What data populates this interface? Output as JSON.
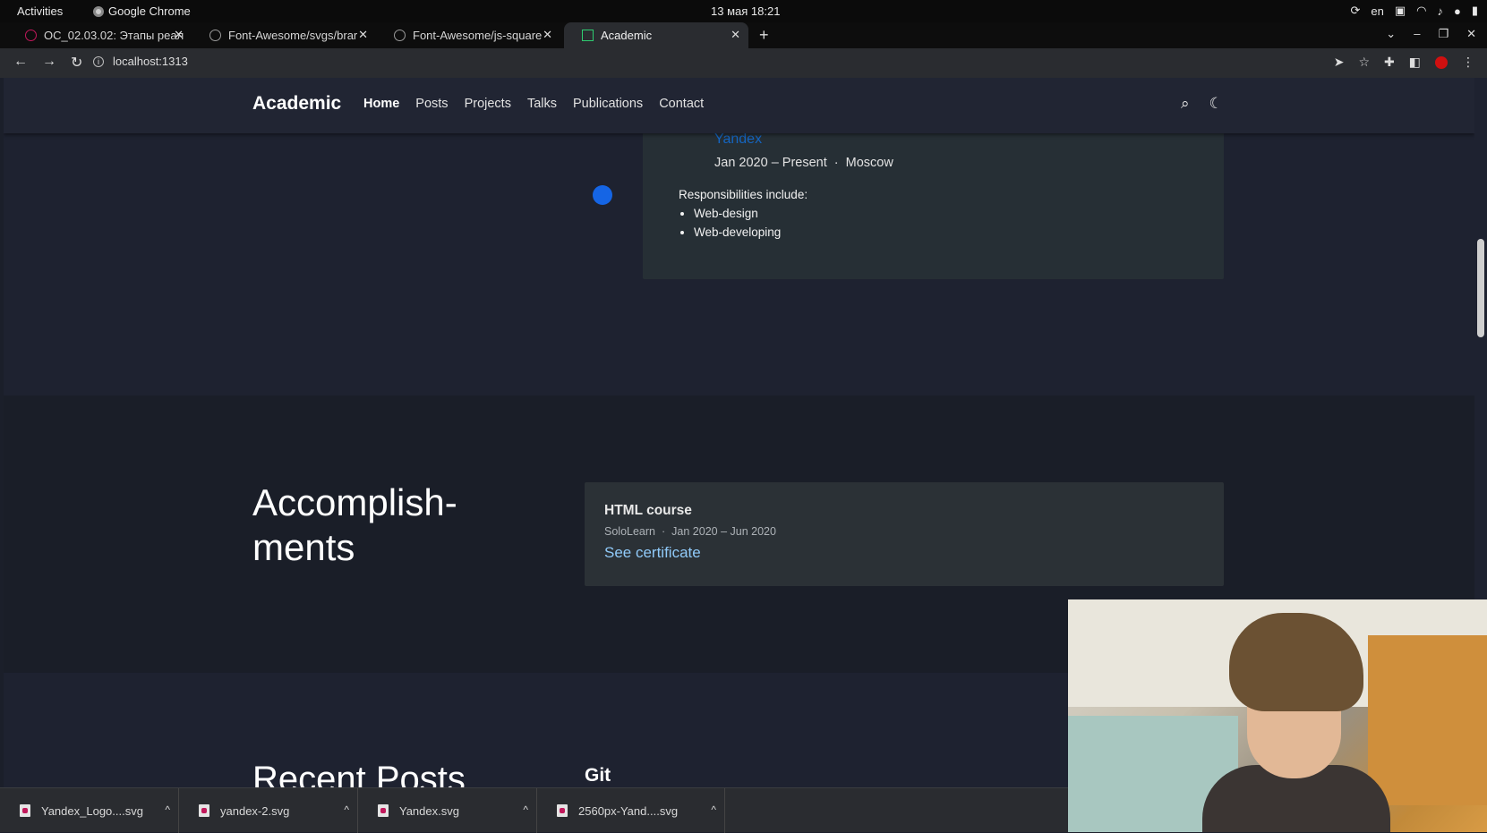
{
  "system_bar": {
    "activities": "Activities",
    "app_name": "Google Chrome",
    "clock": "13 мая  18:21",
    "lang": "en"
  },
  "tabs": [
    {
      "title": "ОС_02.03.02: Этапы реал"
    },
    {
      "title": "Font-Awesome/svgs/brar"
    },
    {
      "title": "Font-Awesome/js-square"
    },
    {
      "title": "Academic"
    }
  ],
  "address_bar": {
    "url": "localhost:1313"
  },
  "site": {
    "brand": "Academic",
    "menu": [
      "Home",
      "Posts",
      "Projects",
      "Talks",
      "Publications",
      "Contact"
    ]
  },
  "experience": {
    "company": "Yandex",
    "dates": "Jan 2020 – Present",
    "separator": "·",
    "location": "Moscow",
    "responsibilities_label": "Responsibilities include:",
    "items": [
      "Web-design",
      "Web-developing"
    ]
  },
  "accomplishments": {
    "section_title_line1": "Accomplish-",
    "section_title_line2": "ments",
    "card": {
      "name": "HTML course",
      "organization": "SoloLearn",
      "separator": "·",
      "dates": "Jan 2020 – Jun 2020",
      "link": "See certificate"
    }
  },
  "recent_posts": {
    "section_title": "Recent Posts",
    "first_post": "Git"
  },
  "downloads": [
    {
      "name": "Yandex_Logo....svg"
    },
    {
      "name": "yandex-2.svg"
    },
    {
      "name": "Yandex.svg"
    },
    {
      "name": "2560px-Yand....svg"
    }
  ],
  "colors": {
    "page_bg": "#1e2230",
    "card_bg": "#262f35",
    "link_blue": "#90caf9",
    "company_blue": "#1565c0"
  }
}
